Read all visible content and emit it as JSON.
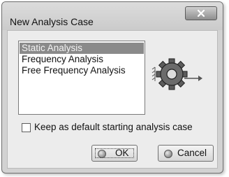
{
  "window": {
    "title": "New Analysis Case",
    "close_label": "x"
  },
  "list": {
    "items": [
      {
        "label": "Static Analysis",
        "selected": true
      },
      {
        "label": "Frequency Analysis",
        "selected": false
      },
      {
        "label": "Free Frequency Analysis",
        "selected": false
      }
    ]
  },
  "checkbox": {
    "label": "Keep as default starting analysis case",
    "checked": false
  },
  "buttons": {
    "ok_label": "OK",
    "cancel_label": "Cancel"
  },
  "icons": {
    "close": "close-icon",
    "gear": "gear-arrow-icon",
    "ok": "ok-icon",
    "cancel": "cancel-icon"
  }
}
